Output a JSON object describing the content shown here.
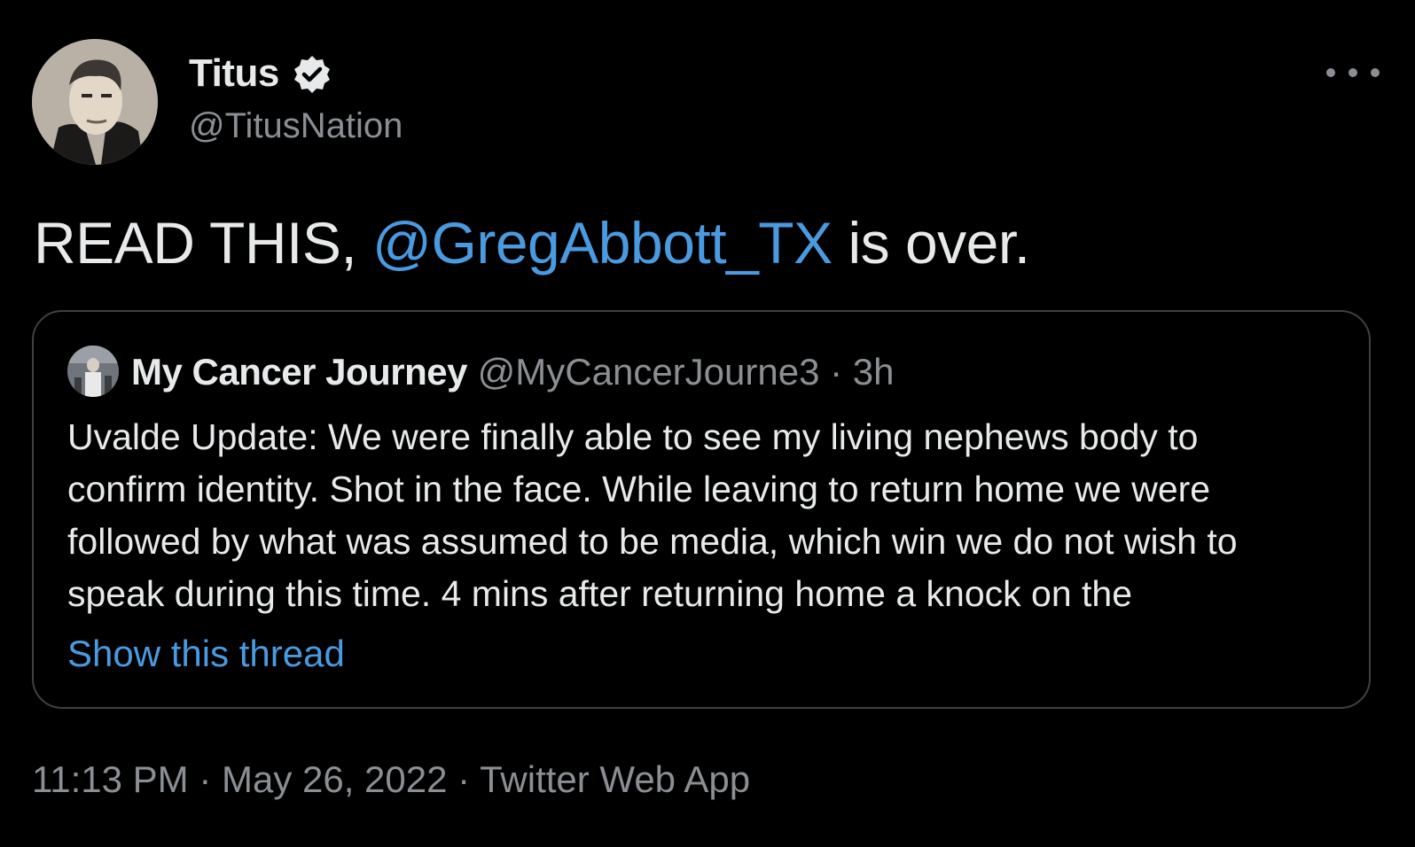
{
  "author": {
    "display_name": "Titus",
    "handle": "@TitusNation",
    "verified_icon": "verified-badge-icon"
  },
  "tweet": {
    "text_before": "READ THIS, ",
    "mention": "@GregAbbott_TX",
    "text_after": " is over."
  },
  "quoted_tweet": {
    "display_name": "My Cancer Journey",
    "handle": "@MyCancerJourne3",
    "separator": " · ",
    "time_ago": "3h",
    "lines": [
      "Uvalde Update: We were finally able to see my living nephews body to",
      "confirm identity. Shot in the face. While leaving to return home we were",
      "followed by what was assumed to be media, which win we do not wish to",
      "speak during this time. 4 mins after returning home a knock on the"
    ],
    "show_thread_label": "Show this thread"
  },
  "footer": {
    "time": "11:13 PM",
    "sep1": " · ",
    "date": "May 26, 2022",
    "sep2": " · ",
    "source": "Twitter Web App"
  },
  "colors": {
    "background": "#000000",
    "text": "#e7e9ea",
    "secondary": "#8b8f93",
    "accent": "#4a9ae0",
    "border": "#3e4144"
  }
}
